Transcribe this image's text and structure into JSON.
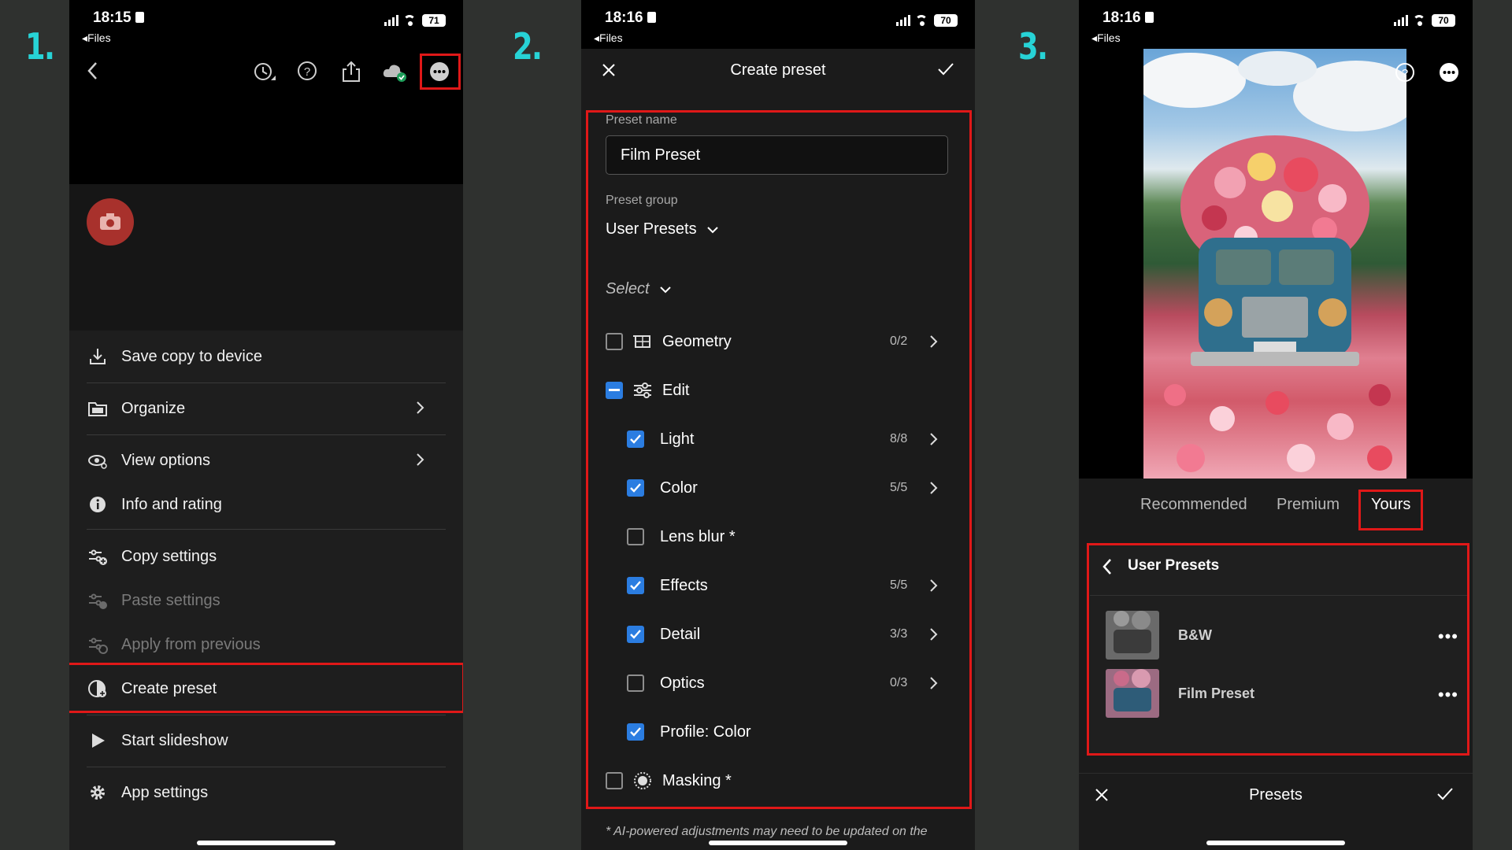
{
  "steps": [
    "1.",
    "2.",
    "3."
  ],
  "status": [
    {
      "time": "18:15",
      "back": "Files",
      "battery": "71"
    },
    {
      "time": "18:16",
      "back": "Files",
      "battery": "70"
    },
    {
      "time": "18:16",
      "back": "Files",
      "battery": "70"
    }
  ],
  "phone1": {
    "menu": [
      {
        "label": "Save copy to device",
        "icon": "download-icon",
        "chevron": false,
        "dim": false
      },
      {
        "label": "Organize",
        "icon": "folder-icon",
        "chevron": true,
        "dim": false
      },
      {
        "label": "View options",
        "icon": "eye-icon",
        "chevron": true,
        "dim": false
      },
      {
        "label": "Info and rating",
        "icon": "info-icon",
        "chevron": false,
        "dim": false
      },
      {
        "label": "Copy settings",
        "icon": "copy-settings-icon",
        "chevron": false,
        "dim": false
      },
      {
        "label": "Paste settings",
        "icon": "paste-settings-icon",
        "chevron": false,
        "dim": true
      },
      {
        "label": "Apply from previous",
        "icon": "apply-previous-icon",
        "chevron": false,
        "dim": true
      },
      {
        "label": "Create preset",
        "icon": "create-preset-icon",
        "chevron": false,
        "dim": false
      },
      {
        "label": "Start slideshow",
        "icon": "play-icon",
        "chevron": false,
        "dim": false
      },
      {
        "label": "App settings",
        "icon": "gear-icon",
        "chevron": false,
        "dim": false
      }
    ]
  },
  "phone2": {
    "title": "Create preset",
    "preset_name_label": "Preset name",
    "preset_name_value": "Film Preset",
    "preset_group_label": "Preset group",
    "preset_group_value": "User Presets",
    "select_label": "Select",
    "rows": [
      {
        "label": "Geometry",
        "state": "off",
        "count": "0/2",
        "chevron": true,
        "indent": false,
        "icon": "geometry-icon"
      },
      {
        "label": "Edit",
        "state": "partial",
        "count": "",
        "chevron": false,
        "indent": false,
        "icon": "sliders-icon"
      },
      {
        "label": "Light",
        "state": "on",
        "count": "8/8",
        "chevron": true,
        "indent": true,
        "icon": ""
      },
      {
        "label": "Color",
        "state": "on",
        "count": "5/5",
        "chevron": true,
        "indent": true,
        "icon": ""
      },
      {
        "label": "Lens blur *",
        "state": "off",
        "count": "",
        "chevron": false,
        "indent": true,
        "icon": ""
      },
      {
        "label": "Effects",
        "state": "on",
        "count": "5/5",
        "chevron": true,
        "indent": true,
        "icon": ""
      },
      {
        "label": "Detail",
        "state": "on",
        "count": "3/3",
        "chevron": true,
        "indent": true,
        "icon": ""
      },
      {
        "label": "Optics",
        "state": "off",
        "count": "0/3",
        "chevron": true,
        "indent": true,
        "icon": ""
      },
      {
        "label": "Profile: Color",
        "state": "on",
        "count": "",
        "chevron": false,
        "indent": true,
        "icon": ""
      },
      {
        "label": "Masking *",
        "state": "off",
        "count": "",
        "chevron": false,
        "indent": false,
        "icon": "masking-icon"
      }
    ],
    "footnote": "* AI-powered adjustments may need to be updated on the"
  },
  "phone3": {
    "tabs": [
      "Recommended",
      "Premium",
      "Yours"
    ],
    "active_tab": "Yours",
    "group_title": "User Presets",
    "presets": [
      "B&W",
      "Film Preset"
    ],
    "bottom_title": "Presets"
  },
  "colors": {
    "accent": "#2b7de1",
    "highlight": "#e01818",
    "step": "#27d3d6"
  }
}
